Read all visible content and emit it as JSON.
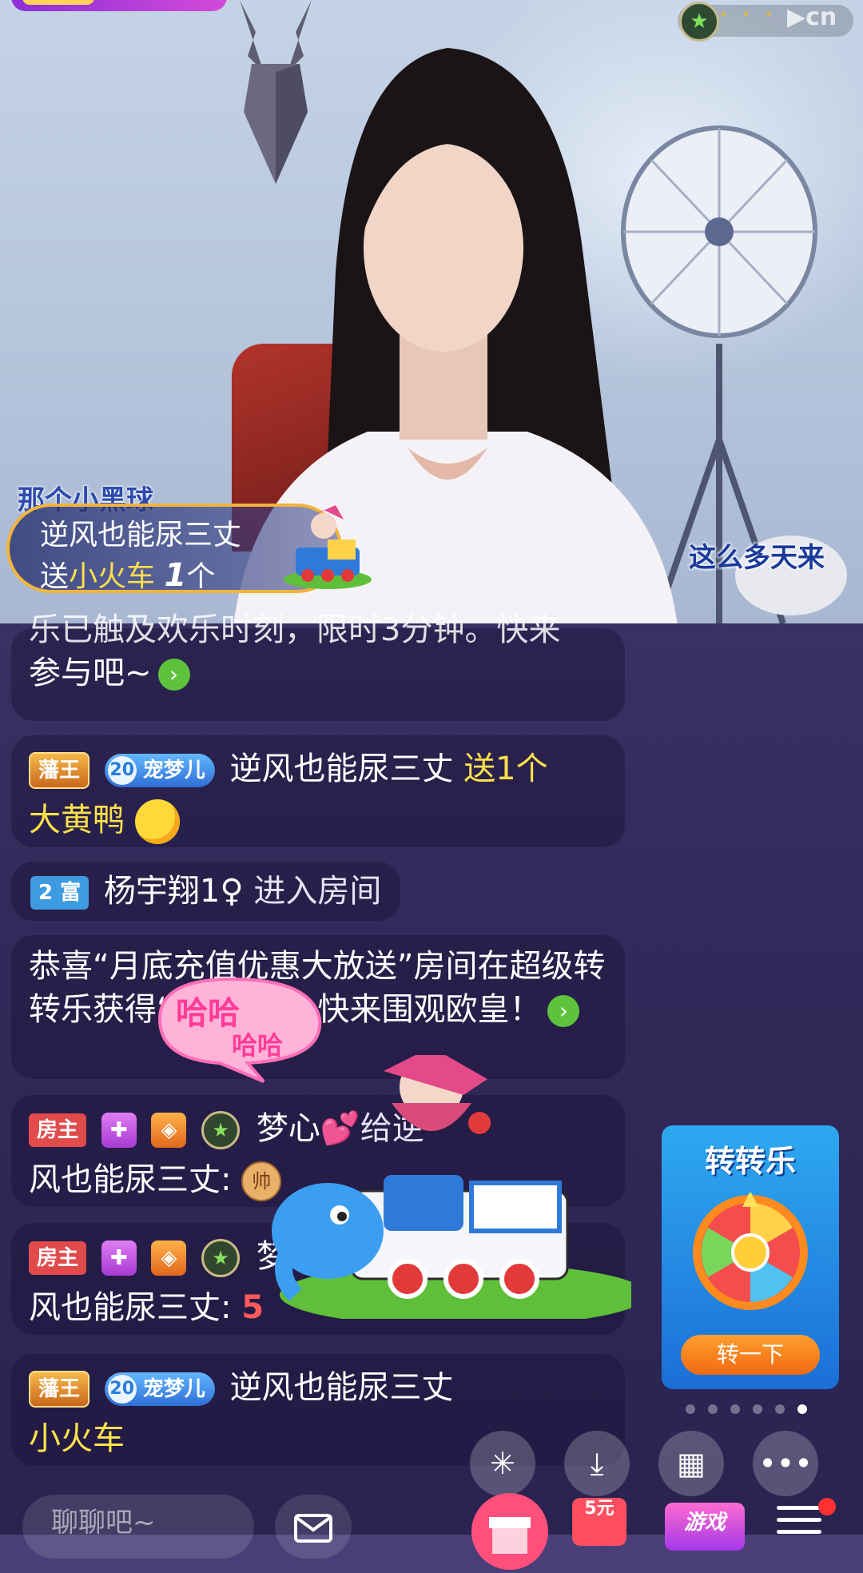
{
  "video": {
    "watermark": "cn",
    "top_name": "那个小黑球",
    "right_text": "这么多天来"
  },
  "gift_banner": {
    "user": "逆风也能尿三丈",
    "send": "送",
    "gift": "小火车",
    "count": "1",
    "unit": "个"
  },
  "chat": [
    {
      "id": "sys1",
      "text_partial": "乐已触及欢乐时刻，限时3分钟。快来",
      "text": "参与吧~"
    },
    {
      "id": "gift_duck",
      "badge1": "藩王",
      "badge2_level": "20",
      "badge2": "宠梦儿",
      "user": "逆风也能尿三丈",
      "action": "送1个",
      "gift": "大黄鸭"
    },
    {
      "id": "enter",
      "rich_level": "2",
      "rich": "富",
      "user": "杨宇翔1♀",
      "action": "进入房间"
    },
    {
      "id": "sys2",
      "text": "恭喜“月底充值优惠大放送”房间在超级转转乐获得“小黑球”，快来围观欧皇！"
    },
    {
      "id": "host1",
      "badge": "房主",
      "user": "梦心",
      "tail": "给逆",
      "line2": "风也能尿三丈:",
      "icon_text": "帅"
    },
    {
      "id": "host2",
      "badge": "房主",
      "user": "梦心",
      "tail": "给逆",
      "line2": "风也能尿三丈:",
      "icon_text": "5"
    },
    {
      "id": "gift_train",
      "badge1": "藩王",
      "badge2_level": "20",
      "badge2": "宠梦儿",
      "user": "逆风也能尿三丈",
      "line2": "小火车"
    }
  ],
  "overlay": {
    "haha_big": "哈哈",
    "haha_small": "哈哈"
  },
  "lucky_wheel": {
    "title": "转转乐",
    "button": "转一下"
  },
  "pager": {
    "count": 6,
    "active": 6
  },
  "bottom": {
    "input_placeholder": "聊聊吧~",
    "yuan_label": "5元",
    "game_label": "游戏"
  },
  "icons": {
    "share": "share-icon",
    "download": "download-icon",
    "apps": "apps-grid-icon",
    "more": "more-icon",
    "mail": "mail-icon",
    "gift": "gift-icon",
    "menu": "menu-icon"
  }
}
